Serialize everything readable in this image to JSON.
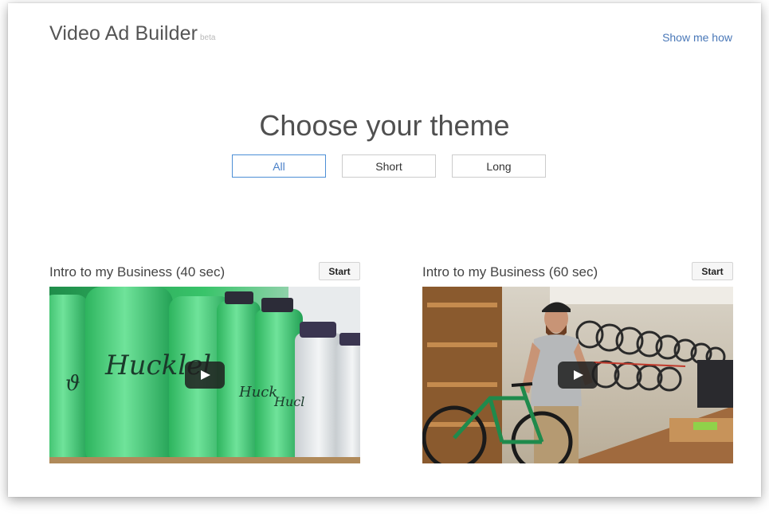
{
  "header": {
    "title": "Video Ad Builder",
    "badge": "beta",
    "help_link": "Show me how"
  },
  "main": {
    "heading": "Choose your theme",
    "filters": [
      {
        "label": "All",
        "active": true
      },
      {
        "label": "Short",
        "active": false
      },
      {
        "label": "Long",
        "active": false
      }
    ],
    "themes": [
      {
        "title": "Intro to my Business (40 sec)",
        "start_label": "Start",
        "thumbnail": "green-water-bottles",
        "thumb_text": "Hucklel"
      },
      {
        "title": "Intro to my Business (60 sec)",
        "start_label": "Start",
        "thumbnail": "bike-shop-man"
      }
    ]
  },
  "colors": {
    "accent": "#4c8fd6",
    "link": "#4a78b8",
    "text": "#555555"
  },
  "icons": [
    "play-icon"
  ]
}
